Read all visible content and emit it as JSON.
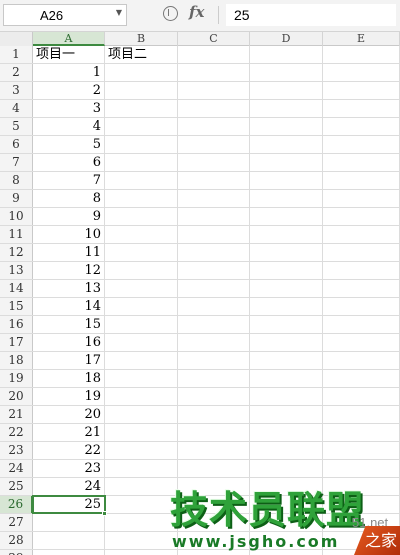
{
  "formula_bar": {
    "name_box": "A26",
    "fx_label": "fx",
    "value": "25"
  },
  "columns": [
    "A",
    "B",
    "C",
    "D",
    "E"
  ],
  "active_column": "A",
  "active_row": 26,
  "rows": [
    {
      "n": "1",
      "a": "项目一",
      "b": "项目二"
    },
    {
      "n": "2",
      "a": "1",
      "b": ""
    },
    {
      "n": "3",
      "a": "2",
      "b": ""
    },
    {
      "n": "4",
      "a": "3",
      "b": ""
    },
    {
      "n": "5",
      "a": "4",
      "b": ""
    },
    {
      "n": "6",
      "a": "5",
      "b": ""
    },
    {
      "n": "7",
      "a": "6",
      "b": ""
    },
    {
      "n": "8",
      "a": "7",
      "b": ""
    },
    {
      "n": "9",
      "a": "8",
      "b": ""
    },
    {
      "n": "10",
      "a": "9",
      "b": ""
    },
    {
      "n": "11",
      "a": "10",
      "b": ""
    },
    {
      "n": "12",
      "a": "11",
      "b": ""
    },
    {
      "n": "13",
      "a": "12",
      "b": ""
    },
    {
      "n": "14",
      "a": "13",
      "b": ""
    },
    {
      "n": "15",
      "a": "14",
      "b": ""
    },
    {
      "n": "16",
      "a": "15",
      "b": ""
    },
    {
      "n": "17",
      "a": "16",
      "b": ""
    },
    {
      "n": "18",
      "a": "17",
      "b": ""
    },
    {
      "n": "19",
      "a": "18",
      "b": ""
    },
    {
      "n": "20",
      "a": "19",
      "b": ""
    },
    {
      "n": "21",
      "a": "20",
      "b": ""
    },
    {
      "n": "22",
      "a": "21",
      "b": ""
    },
    {
      "n": "23",
      "a": "22",
      "b": ""
    },
    {
      "n": "24",
      "a": "23",
      "b": ""
    },
    {
      "n": "25",
      "a": "24",
      "b": ""
    },
    {
      "n": "26",
      "a": "25",
      "b": ""
    },
    {
      "n": "27",
      "a": "",
      "b": ""
    },
    {
      "n": "28",
      "a": "",
      "b": ""
    },
    {
      "n": "29",
      "a": "",
      "b": ""
    }
  ],
  "watermark": {
    "main": "技术员联盟",
    "sub": "www.jsgho.com",
    "net": "51.net",
    "badge": "之家"
  },
  "colors": {
    "selection": "#3d8a40",
    "watermark_green": "#2fa23a"
  }
}
